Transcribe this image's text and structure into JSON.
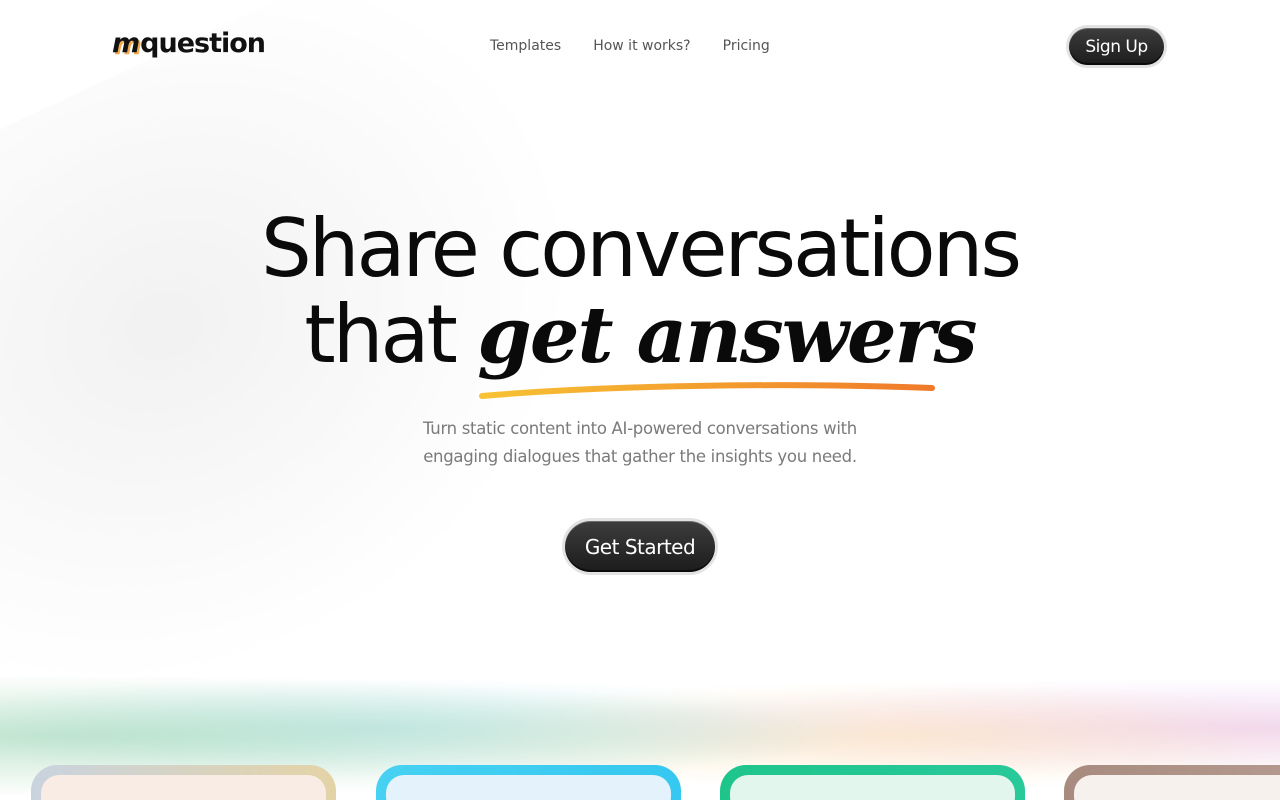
{
  "brand": {
    "logo_mark": "m",
    "logo_text": "question"
  },
  "nav": {
    "items": [
      {
        "label": "Templates"
      },
      {
        "label": "How it works?"
      },
      {
        "label": "Pricing"
      }
    ],
    "signup_label": "Sign Up"
  },
  "hero": {
    "title_line1": "Share conversations",
    "title_line2_plain": "that ",
    "title_line2_accent": "get answers",
    "subtitle_line1": "Turn static content into AI-powered conversations with",
    "subtitle_line2": "engaging dialogues that gather the insights you need.",
    "cta_label": "Get Started"
  },
  "colors": {
    "underline_start": "#f7c233",
    "underline_end": "#ef7a2a",
    "button_dark": "#2a2a2a"
  }
}
